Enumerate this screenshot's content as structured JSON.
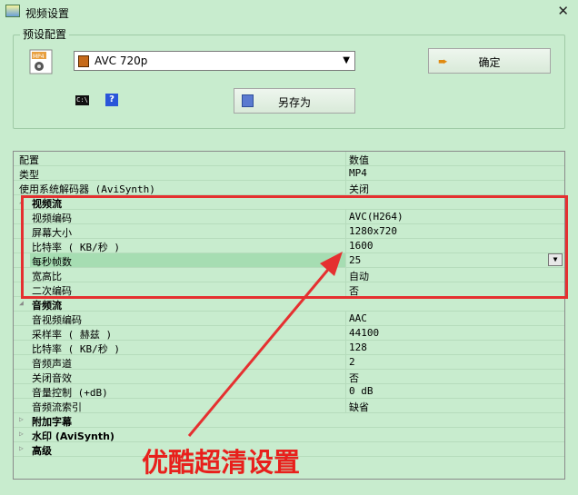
{
  "window": {
    "title": "视频设置",
    "close_glyph": "✕"
  },
  "preset": {
    "group_label": "预设配置",
    "selected": "AVC 720p",
    "ok_label": "确定",
    "save_as_label": "另存为",
    "cmd_icon_text": "C:\\",
    "help_icon_text": "?"
  },
  "grid": {
    "header": {
      "name": "配置",
      "value": "数值"
    },
    "rows": [
      {
        "name": "类型",
        "value": "MP4"
      },
      {
        "name": "使用系统解码器 (AviSynth)",
        "value": "关闭"
      },
      {
        "name": "视频流",
        "value": ""
      },
      {
        "name": "视频编码",
        "value": "AVC(H264)"
      },
      {
        "name": "屏幕大小",
        "value": "1280x720"
      },
      {
        "name": "比特率 ( KB/秒 )",
        "value": "1600"
      },
      {
        "name": "每秒帧数",
        "value": "25"
      },
      {
        "name": "宽高比",
        "value": "自动"
      },
      {
        "name": "二次编码",
        "value": "否"
      },
      {
        "name": "音频流",
        "value": ""
      },
      {
        "name": "音视频编码",
        "value": "AAC"
      },
      {
        "name": "采样率 ( 赫兹 )",
        "value": "44100"
      },
      {
        "name": "比特率 ( KB/秒 )",
        "value": "128"
      },
      {
        "name": "音频声道",
        "value": "2"
      },
      {
        "name": "关闭音效",
        "value": "否"
      },
      {
        "name": "音量控制 (+dB)",
        "value": "0 dB"
      },
      {
        "name": "音频流索引",
        "value": "缺省"
      },
      {
        "name": "附加字幕",
        "value": ""
      },
      {
        "name": "水印 (AviSynth)",
        "value": ""
      },
      {
        "name": "高级",
        "value": ""
      }
    ]
  },
  "annotation": {
    "text": "优酷超清设置",
    "color": "#e8201c"
  }
}
